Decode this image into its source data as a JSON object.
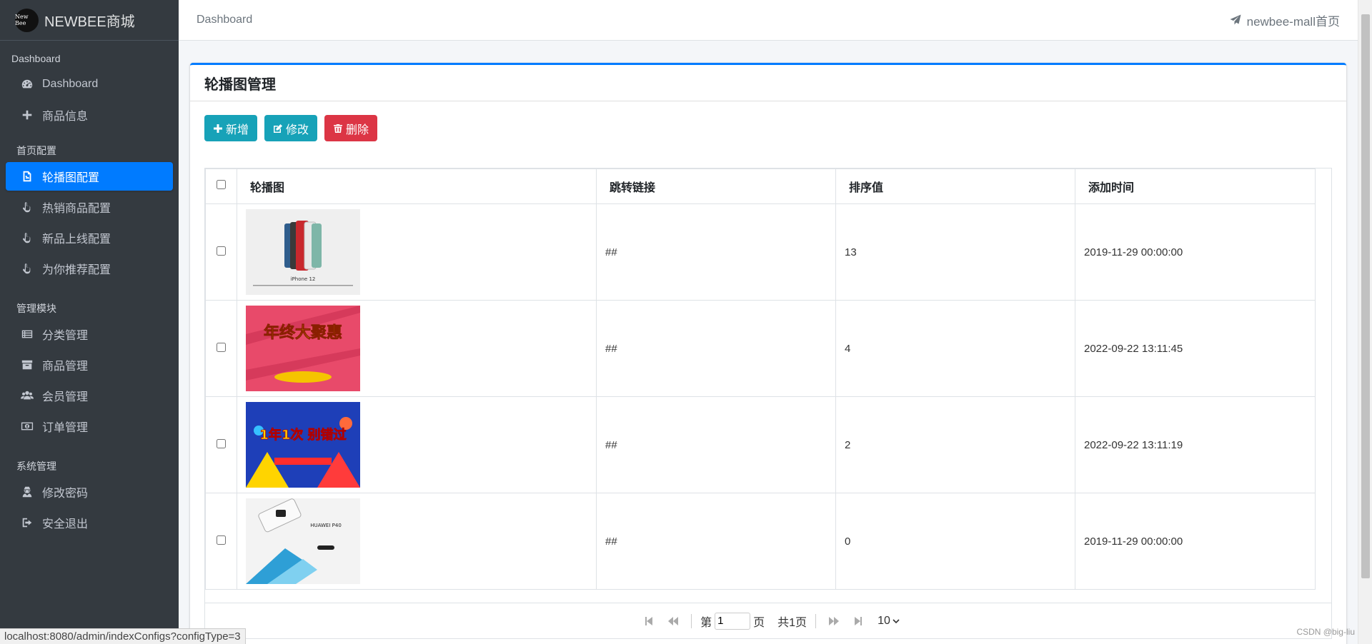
{
  "brand": {
    "logo_text": "New Bee",
    "title": "NEWBEE商城"
  },
  "sidebar": {
    "sections": [
      {
        "header": "Dashboard",
        "items": [
          {
            "label": "Dashboard",
            "icon": "dashboard-icon"
          },
          {
            "label": "商品信息",
            "icon": "plus-icon"
          }
        ]
      },
      {
        "header": "首页配置",
        "items": [
          {
            "label": "轮播图配置",
            "icon": "image-icon",
            "active": true
          },
          {
            "label": "热销商品配置",
            "icon": "hand-pointer-icon"
          },
          {
            "label": "新品上线配置",
            "icon": "hand-pointer-icon"
          },
          {
            "label": "为你推荐配置",
            "icon": "hand-pointer-icon"
          }
        ]
      },
      {
        "header": "管理模块",
        "items": [
          {
            "label": "分类管理",
            "icon": "list-icon"
          },
          {
            "label": "商品管理",
            "icon": "archive-icon"
          },
          {
            "label": "会员管理",
            "icon": "users-icon"
          },
          {
            "label": "订单管理",
            "icon": "money-icon"
          }
        ]
      },
      {
        "header": "系统管理",
        "items": [
          {
            "label": "修改密码",
            "icon": "user-secret-icon"
          },
          {
            "label": "安全退出",
            "icon": "sign-out-icon"
          }
        ]
      }
    ]
  },
  "topnav": {
    "breadcrumb": "Dashboard",
    "home_link": "newbee-mall首页"
  },
  "card": {
    "title": "轮播图管理"
  },
  "toolbar": {
    "add_label": "新增",
    "edit_label": "修改",
    "delete_label": "删除"
  },
  "table": {
    "headers": [
      "轮播图",
      "跳转链接",
      "排序值",
      "添加时间"
    ],
    "rows": [
      {
        "image": "iPhone 12",
        "link": "##",
        "rank": "13",
        "time": "2019-11-29 00:00:00"
      },
      {
        "image": "年终大聚惠",
        "link": "##",
        "rank": "4",
        "time": "2022-09-22 13:11:45"
      },
      {
        "image": "1年1次 别错过",
        "link": "##",
        "rank": "2",
        "time": "2022-09-22 13:11:19"
      },
      {
        "image": "HUAWEI P40",
        "link": "##",
        "rank": "0",
        "time": "2019-11-29 00:00:00"
      }
    ]
  },
  "pager": {
    "prefix": "第",
    "page": "1",
    "suffix": "页",
    "total": "共1页",
    "page_size": "10"
  },
  "status_url": "localhost:8080/admin/indexConfigs?configType=3",
  "watermark": "CSDN @big-liu",
  "colors": {
    "sidebar_bg": "#343a40",
    "primary": "#007bff",
    "info": "#17a2b8",
    "danger": "#dc3545"
  }
}
